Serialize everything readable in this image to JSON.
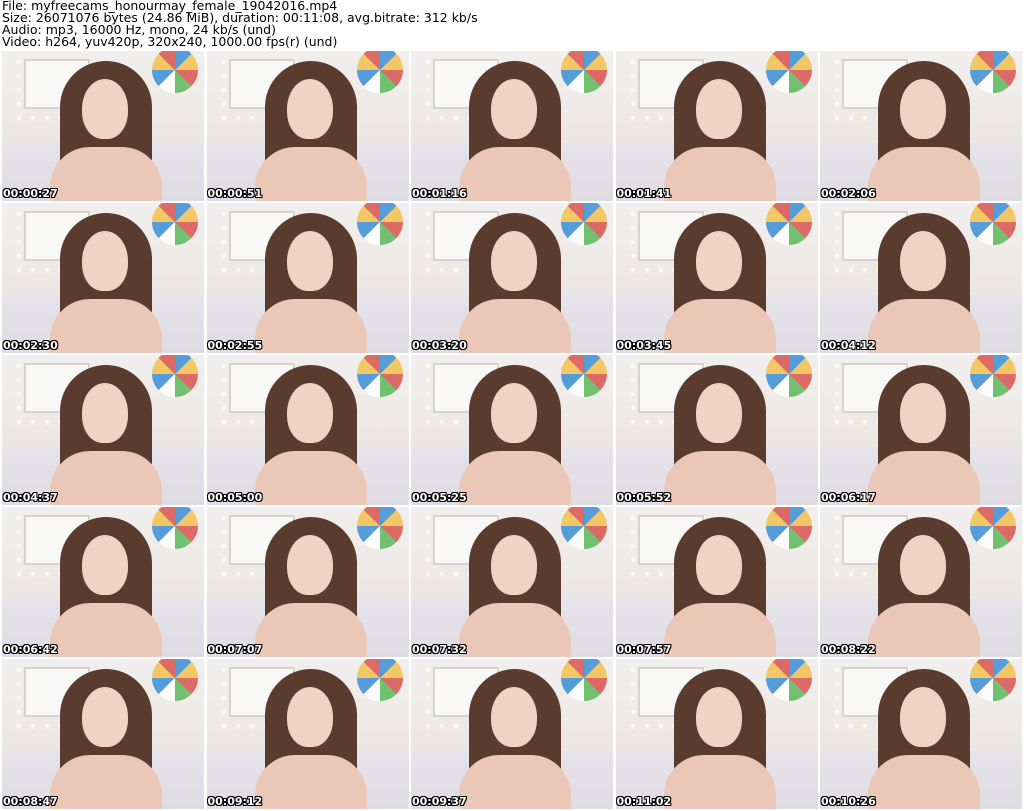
{
  "header": {
    "file": "File: myfreecams_honourmay_female_19042016.mp4",
    "size": "Size: 26071076 bytes (24.86 MiB), duration: 00:11:08, avg.bitrate: 312 kb/s",
    "audio": "Audio: mp3, 16000 Hz, mono, 24 kb/s (und)",
    "video": "Video: h264, yuv420p, 320x240, 1000.00 fps(r) (und)"
  },
  "thumbnails": [
    {
      "time": "00:00:27"
    },
    {
      "time": "00:00:51"
    },
    {
      "time": "00:01:16"
    },
    {
      "time": "00:01:41"
    },
    {
      "time": "00:02:06"
    },
    {
      "time": "00:02:30"
    },
    {
      "time": "00:02:55"
    },
    {
      "time": "00:03:20"
    },
    {
      "time": "00:03:45"
    },
    {
      "time": "00:04:12"
    },
    {
      "time": "00:04:37"
    },
    {
      "time": "00:05:00"
    },
    {
      "time": "00:05:25"
    },
    {
      "time": "00:05:52"
    },
    {
      "time": "00:06:17"
    },
    {
      "time": "00:06:42"
    },
    {
      "time": "00:07:07"
    },
    {
      "time": "00:07:32"
    },
    {
      "time": "00:07:57"
    },
    {
      "time": "00:08:22"
    },
    {
      "time": "00:08:47"
    },
    {
      "time": "00:09:12"
    },
    {
      "time": "00:09:37"
    },
    {
      "time": "00:11:02"
    },
    {
      "time": "00:10:26"
    }
  ]
}
